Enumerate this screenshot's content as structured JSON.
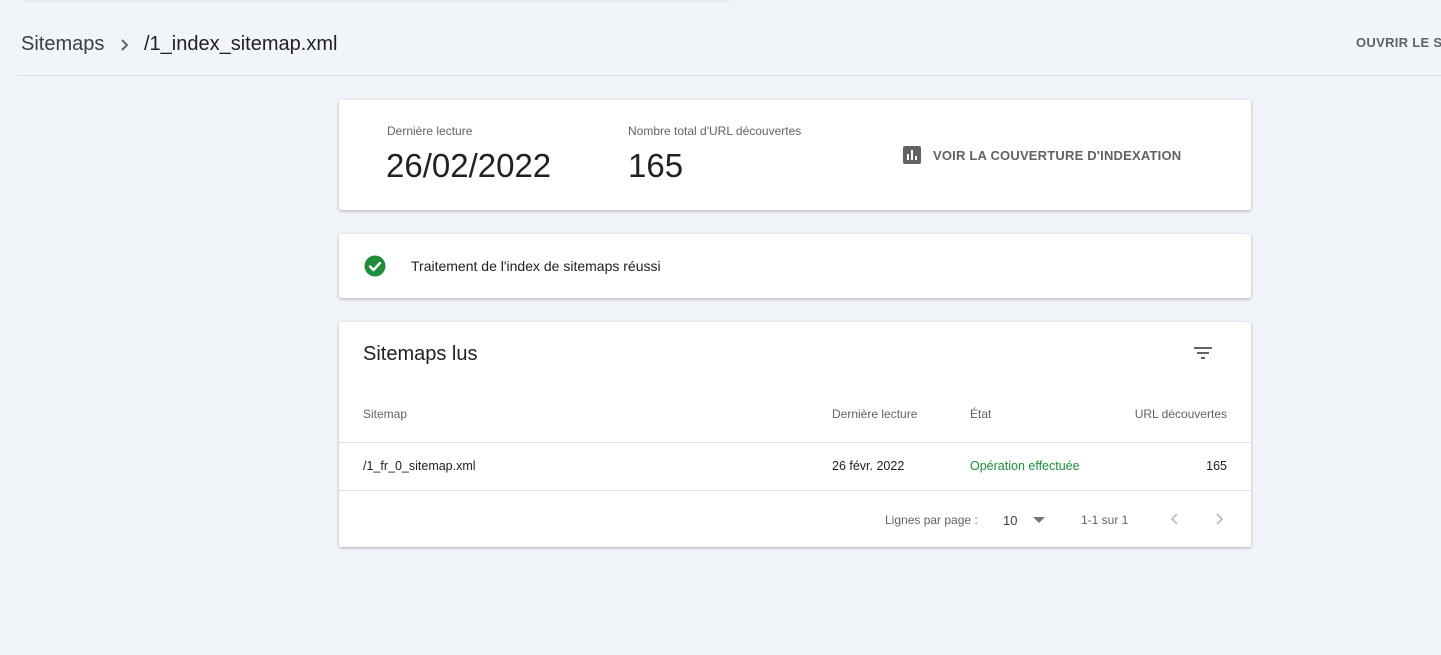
{
  "header": {
    "breadcrumb_root": "Sitemaps",
    "breadcrumb_current": "/1_index_sitemap.xml",
    "open_link": "OUVRIR LE SITEMAP"
  },
  "stats": {
    "last_read_label": "Dernière lecture",
    "last_read_value": "26/02/2022",
    "total_urls_label": "Nombre total d'URL découvertes",
    "total_urls_value": "165",
    "coverage_button": "VOIR LA COUVERTURE D'INDEXATION",
    "coverage_icon": "bar-chart-icon"
  },
  "status": {
    "icon": "check-circle-icon",
    "message": "Traitement de l'index de sitemaps réussi",
    "color": "#1e8e3e"
  },
  "table": {
    "title": "Sitemaps lus",
    "filter_icon": "filter-icon",
    "columns": [
      "Sitemap",
      "Dernière lecture",
      "État",
      "URL découvertes"
    ],
    "rows": [
      {
        "sitemap": "/1_fr_0_sitemap.xml",
        "last_read": "26 févr. 2022",
        "state": "Opération effectuée",
        "urls": "165"
      }
    ],
    "pagination": {
      "rows_per_page_label": "Lignes par page :",
      "rows_per_page_value": "10",
      "range": "1-1 sur 1"
    }
  },
  "colors": {
    "background": "#f1f4f9",
    "success": "#1e8e3e",
    "icon_gray": "#5f6368"
  }
}
